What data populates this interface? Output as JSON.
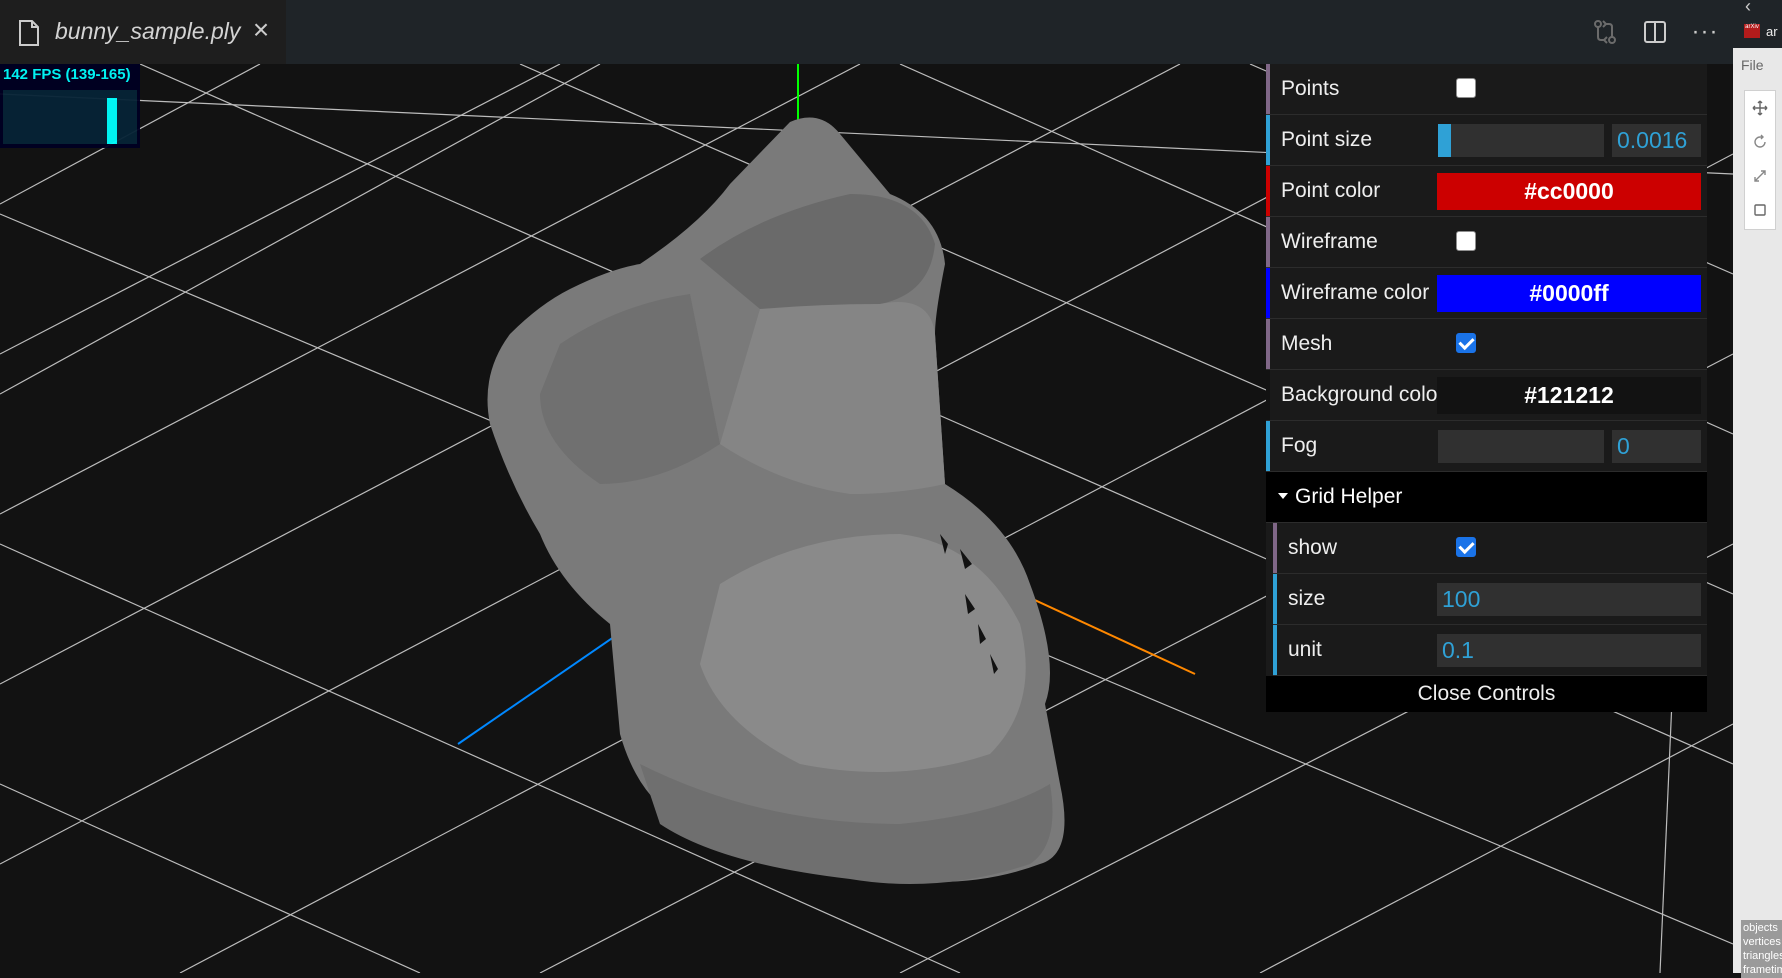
{
  "tab": {
    "title": "bunny_sample.ply",
    "close_icon": "×"
  },
  "tab_actions": [
    {
      "name": "source-control-compare-icon"
    },
    {
      "name": "split-editor-icon"
    },
    {
      "name": "more-actions-icon",
      "glyph": "···"
    }
  ],
  "stats": {
    "fps_text": "142 FPS (139-165)",
    "fps": 142,
    "min": 139,
    "max": 165,
    "color": "#00ffff"
  },
  "gui": {
    "rows": [
      {
        "label": "Points",
        "type": "checkbox",
        "checked": false,
        "accent": "#806787"
      },
      {
        "label": "Point size",
        "type": "slider",
        "value": "0.0016",
        "fill": 0.08,
        "accent": "#2fa1d6"
      },
      {
        "label": "Point color",
        "type": "color",
        "value": "#cc0000",
        "accent": "#cc0000"
      },
      {
        "label": "Wireframe",
        "type": "checkbox",
        "checked": false,
        "accent": "#806787"
      },
      {
        "label": "Wireframe color",
        "type": "color",
        "value": "#0000ff",
        "accent": "#0000ff"
      },
      {
        "label": "Mesh",
        "type": "checkbox",
        "checked": true,
        "accent": "#806787"
      },
      {
        "label": "Background color",
        "type": "color",
        "value": "#121212",
        "accent": "#121212"
      },
      {
        "label": "Fog",
        "type": "slider",
        "value": "0",
        "fill": 0,
        "accent": "#2fa1d6"
      }
    ],
    "folder": {
      "title": "Grid Helper",
      "rows": [
        {
          "label": "show",
          "type": "checkbox",
          "checked": true,
          "accent": "#806787"
        },
        {
          "label": "size",
          "type": "number",
          "value": "100",
          "accent": "#2fa1d6"
        },
        {
          "label": "unit",
          "type": "number",
          "value": "0.1",
          "accent": "#2fa1d6"
        }
      ]
    },
    "close_label": "Close Controls"
  },
  "scene": {
    "background": "#121212",
    "grid_color": "#d0d0d0",
    "mesh_color": "#7a7a7a",
    "axis_x_color": "#ff8800",
    "axis_y_color": "#00ff00",
    "axis_z_color": "#0088ff"
  },
  "sidebar": {
    "logo_text": "arXiv",
    "ar_text": "ar",
    "file_label": "File",
    "tools": [
      "move-icon",
      "rotate-icon",
      "scale-icon",
      "select-box-icon"
    ],
    "info_lines": [
      "objects",
      "vertices",
      "triangles",
      "frametime"
    ]
  }
}
